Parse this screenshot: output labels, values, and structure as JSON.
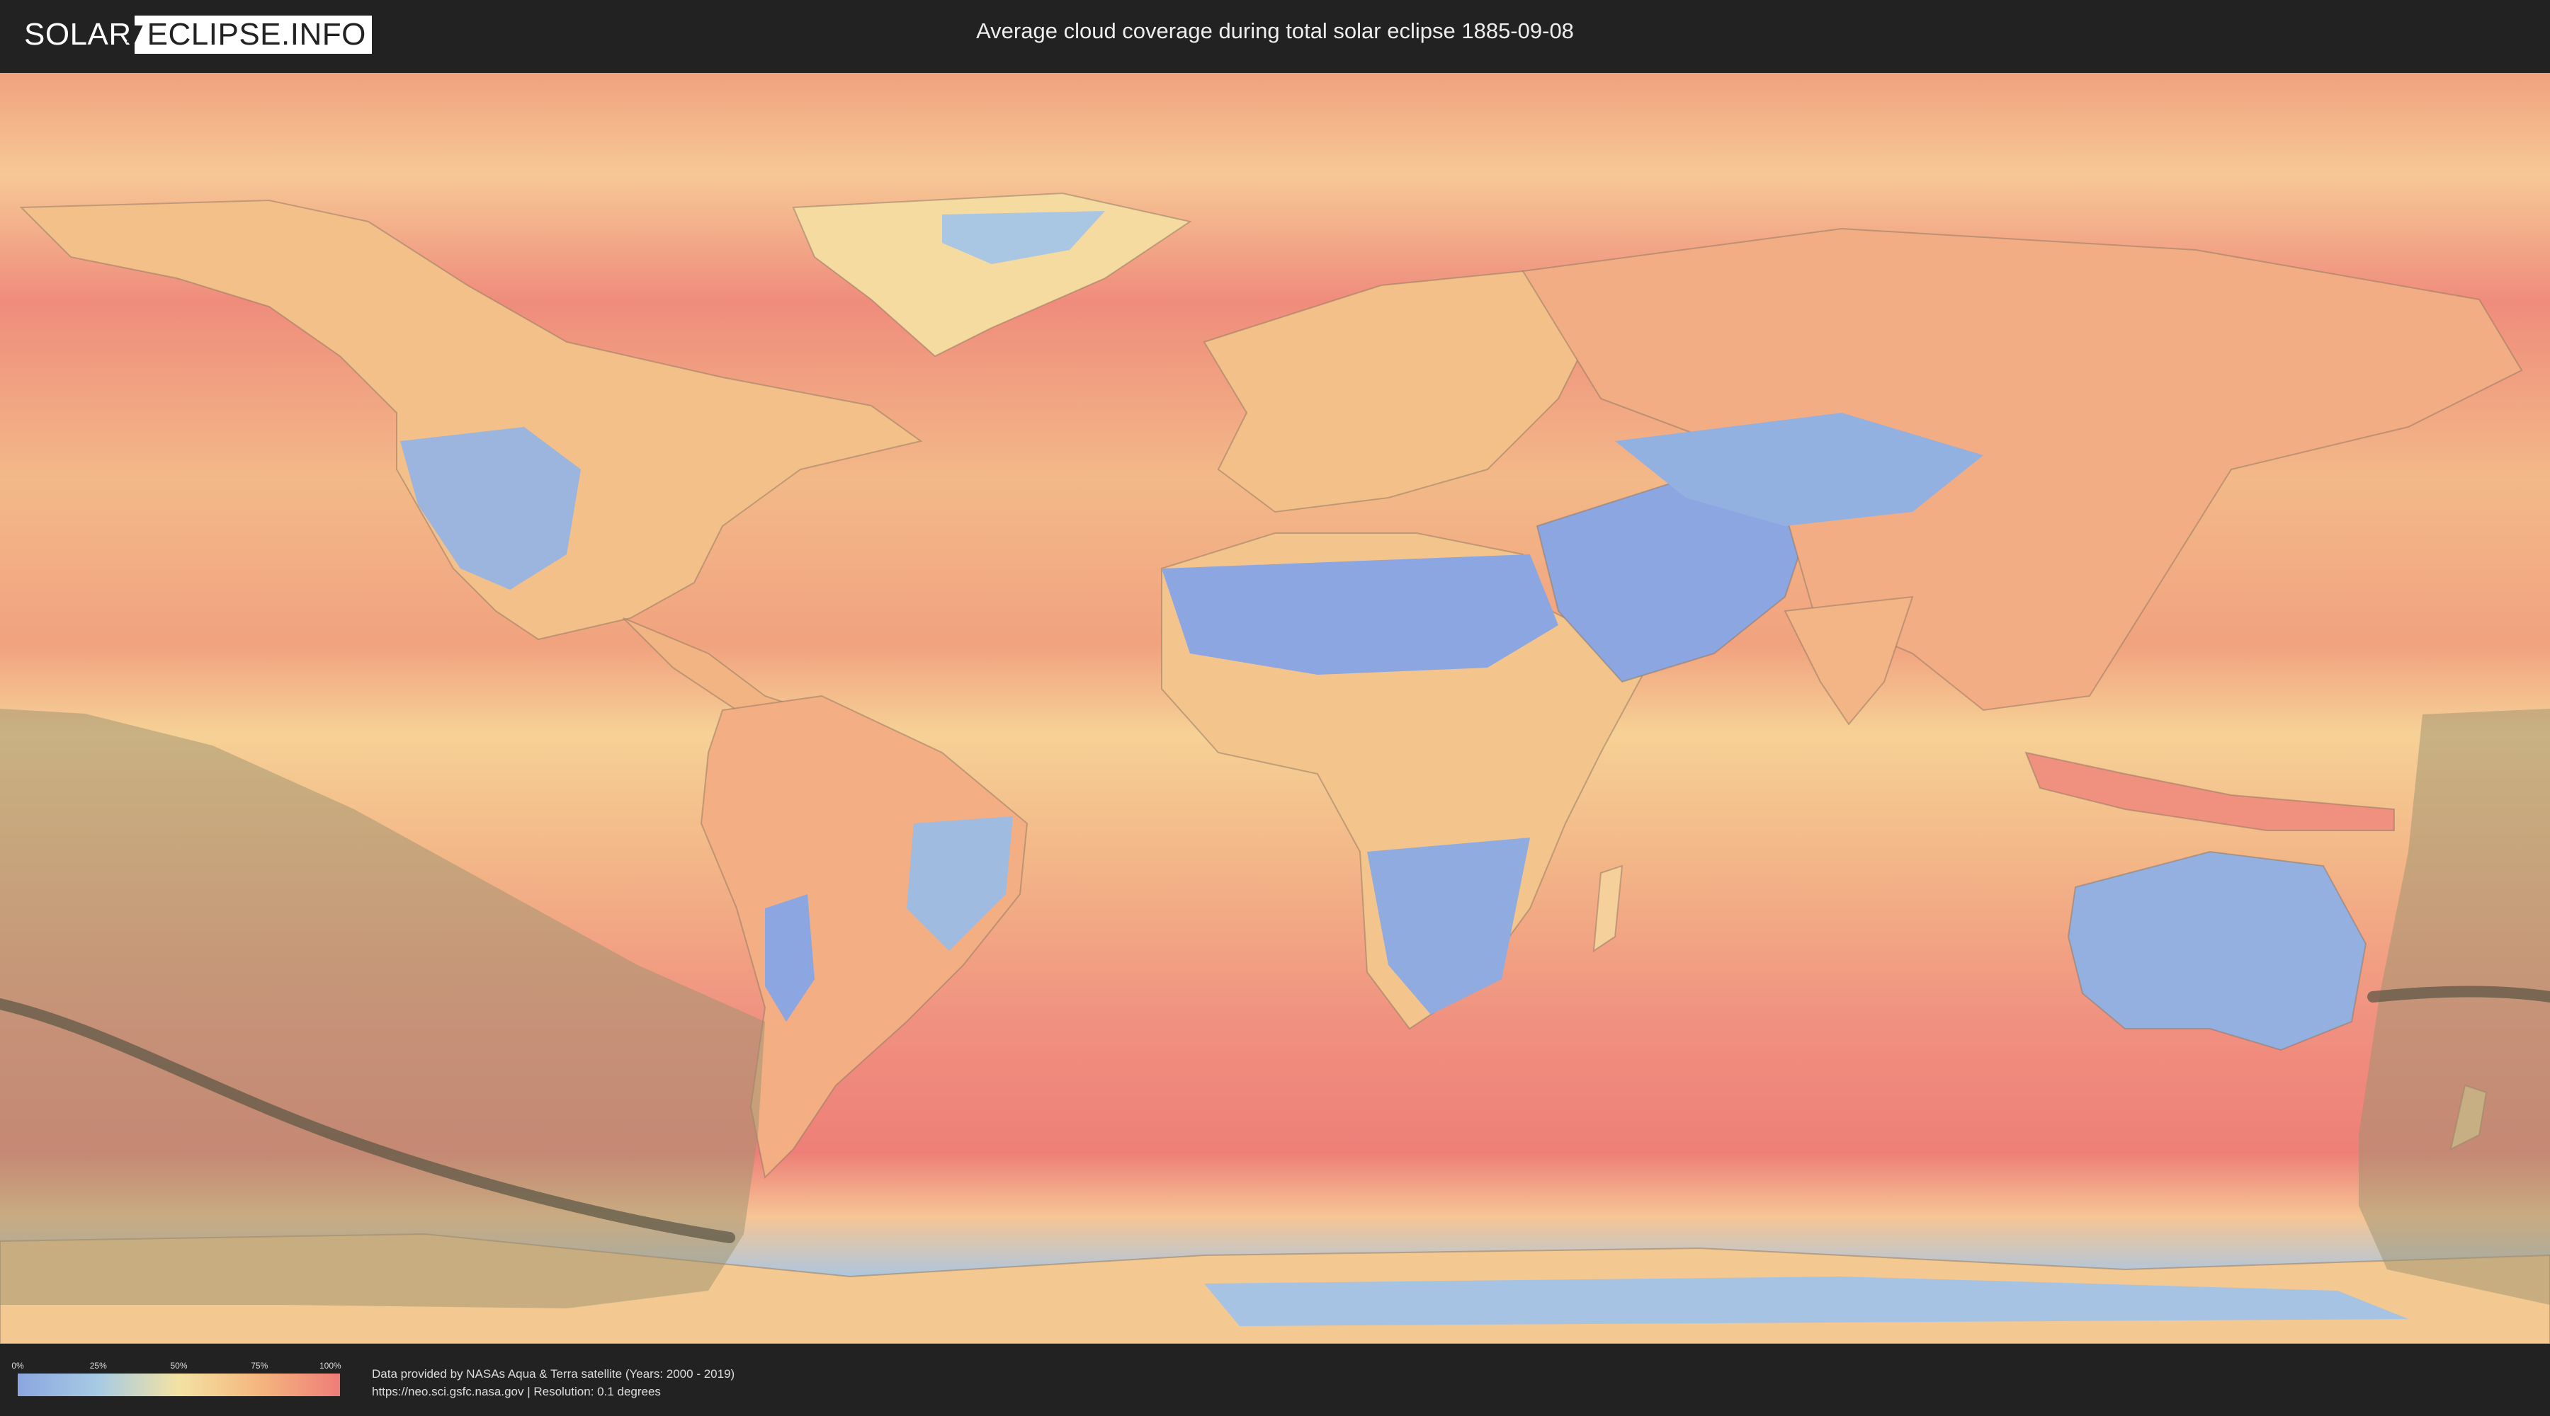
{
  "header": {
    "logo_solar": "SOLAR",
    "logo_eclipse": "ECLIPSE.INFO",
    "title": "Average cloud coverage during total solar eclipse 1885-09-08"
  },
  "legend": {
    "ticks": [
      "0%",
      "25%",
      "50%",
      "75%",
      "100%"
    ],
    "colors": [
      "#8ba6e0",
      "#a7cbe3",
      "#f3e2a3",
      "#f4b67e",
      "#ef7d78"
    ]
  },
  "credits": {
    "line1": "Data provided by NASAs Aqua & Terra satellite (Years: 2000 - 2019)",
    "line2": "https://neo.sci.gsfc.nasa.gov | Resolution: 0.1 degrees"
  },
  "map": {
    "cloud_colors": {
      "clear": "#8ba6e0",
      "low": "#a7cbe3",
      "mid": "#f3e2a3",
      "high": "#f4b67e",
      "overcast": "#ef7d78"
    },
    "eclipse_visibility_color": "#9b9270",
    "totality_path_color": "#5f5847"
  }
}
